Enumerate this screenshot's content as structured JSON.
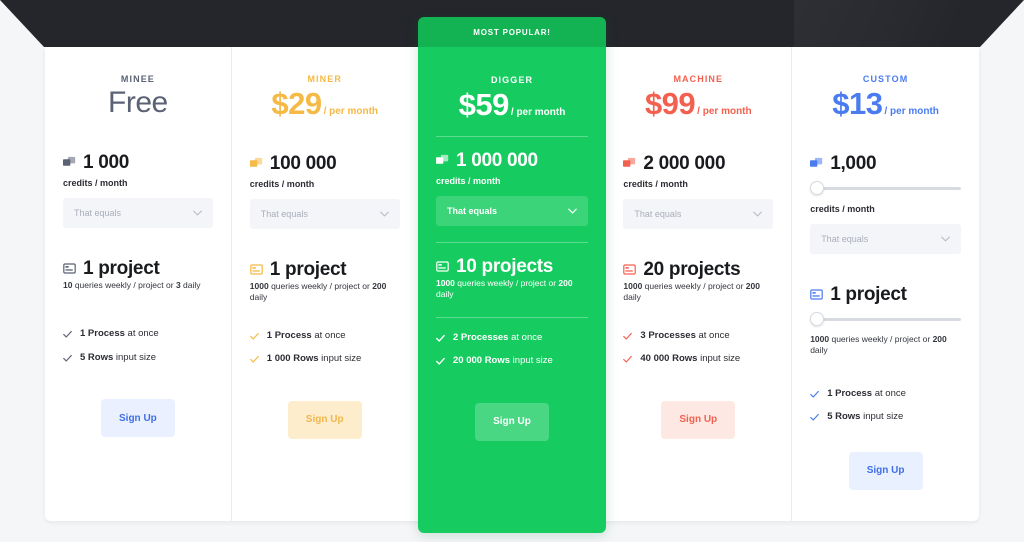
{
  "featured_ribbon": "MOST POPULAR!",
  "select_placeholder": "That equals",
  "signup_label": "Sign Up",
  "colors": {
    "free": "#5a6274",
    "miner": "#f5b945",
    "digger": "#16cc60",
    "machine": "#f4604f",
    "custom": "#4a7cf0",
    "header_dark": "#24262b"
  },
  "plans": [
    {
      "name": "MINEE",
      "price": "Free",
      "per": "",
      "credits_value": "1 000",
      "credits_label": "credits / month",
      "projects_value": "1 project",
      "projects_note_a": "10",
      "projects_note_b": " queries weekly / project or ",
      "projects_note_c": "3",
      "projects_note_d": " daily",
      "feat1_bold": "1 Process",
      "feat1_rest": " at once",
      "feat2_bold": "5 Rows",
      "feat2_rest": " input size",
      "signup": "Sign Up",
      "has_slider": false
    },
    {
      "name": "MINER",
      "price": "$29",
      "per": "/ per month",
      "credits_value": "100 000",
      "credits_label": "credits / month",
      "projects_value": "1 project",
      "projects_note_a": "1000",
      "projects_note_b": " queries weekly / project or ",
      "projects_note_c": "200",
      "projects_note_d": " daily",
      "feat1_bold": "1 Process",
      "feat1_rest": " at once",
      "feat2_bold": "1 000 Rows",
      "feat2_rest": " input size",
      "signup": "Sign Up",
      "has_slider": false
    },
    {
      "name": "DIGGER",
      "price": "$59",
      "per": "/ per month",
      "credits_value": "1 000 000",
      "credits_label": "credits / month",
      "projects_value": "10 projects",
      "projects_note_a": "1000",
      "projects_note_b": " queries weekly / project or ",
      "projects_note_c": "200",
      "projects_note_d": " daily",
      "feat1_bold": "2 Processes",
      "feat1_rest": " at once",
      "feat2_bold": "20 000 Rows",
      "feat2_rest": " input size",
      "signup": "Sign Up",
      "has_slider": false
    },
    {
      "name": "MACHINE",
      "price": "$99",
      "per": "/ per month",
      "credits_value": "2 000 000",
      "credits_label": "credits / month",
      "projects_value": "20 projects",
      "projects_note_a": "1000",
      "projects_note_b": " queries weekly / project or ",
      "projects_note_c": "200",
      "projects_note_d": " daily",
      "feat1_bold": "3 Processes",
      "feat1_rest": " at once",
      "feat2_bold": "40 000 Rows",
      "feat2_rest": " input size",
      "signup": "Sign Up",
      "has_slider": false
    },
    {
      "name": "CUSTOM",
      "price": "$13",
      "per": "/ per month",
      "credits_value": "1,000",
      "credits_label": "credits / month",
      "projects_value": "1 project",
      "projects_note_a": "1000",
      "projects_note_b": " queries weekly / project or ",
      "projects_note_c": "200",
      "projects_note_d": " daily",
      "feat1_bold": "1 Process",
      "feat1_rest": " at once",
      "feat2_bold": "5 Rows",
      "feat2_rest": " input size",
      "signup": "Sign Up",
      "has_slider": true
    }
  ]
}
